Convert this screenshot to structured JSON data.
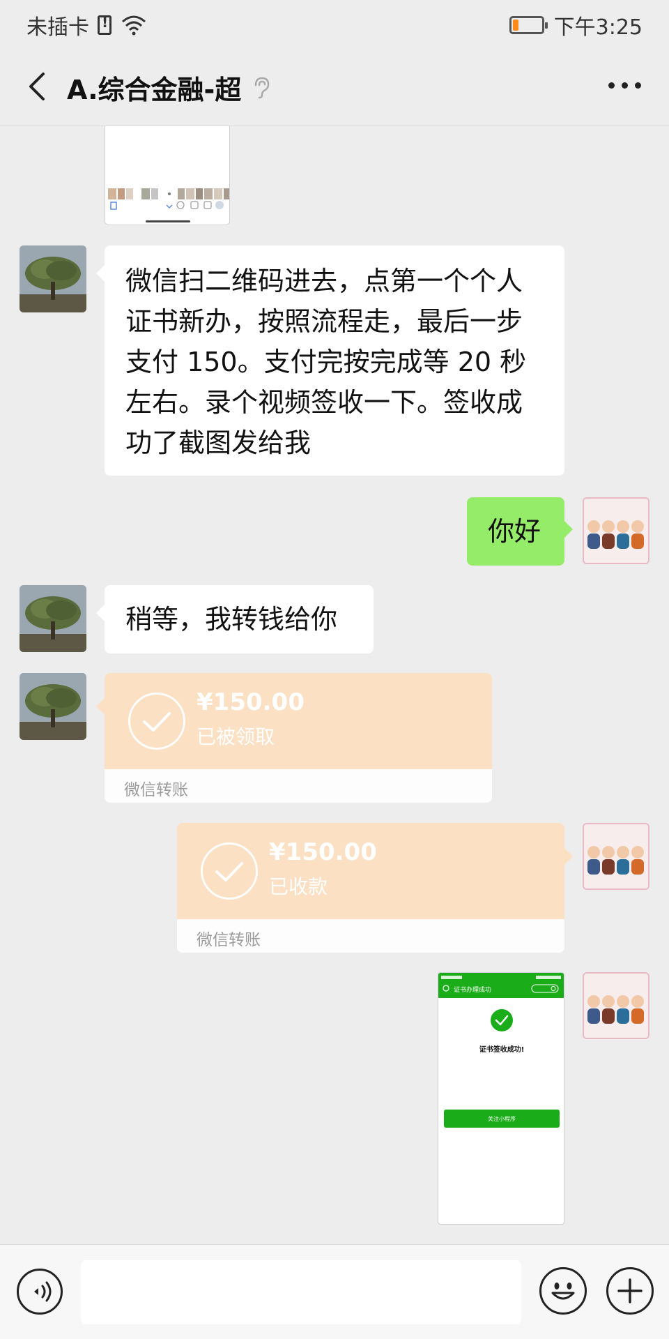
{
  "status_bar": {
    "carrier": "未插卡",
    "time": "下午3:25",
    "battery_level": 0.2,
    "battery_color": "#ff8a1a"
  },
  "header": {
    "title": "A.综合金融-超",
    "back_icon": "chevron-left-icon",
    "mute_icon": "ear-icon",
    "more_icon": "more-dots-icon"
  },
  "messages": [
    {
      "type": "image",
      "side": "in"
    },
    {
      "type": "text",
      "side": "in",
      "text": "微信扫二维码进去，点第一个个人证书新办，按照流程走，最后一步支付 150。支付完按完成等 20 秒左右。录个视频签收一下。签收成功了截图发给我"
    },
    {
      "type": "text",
      "side": "out",
      "text": "你好"
    },
    {
      "type": "text",
      "side": "in",
      "text": "稍等，我转钱给你"
    },
    {
      "type": "transfer",
      "side": "in",
      "amount": "¥150.00",
      "status": "已被领取",
      "label": "微信转账"
    },
    {
      "type": "transfer",
      "side": "out",
      "amount": "¥150.00",
      "status": "已收款",
      "label": "微信转账"
    },
    {
      "type": "image",
      "side": "out",
      "inner_title": "证书办理成功",
      "inner_text": "证书签收成功!",
      "inner_button": "关注小程序"
    }
  ],
  "colors": {
    "outgoing_bubble": "#95ec69",
    "incoming_bubble": "#ffffff",
    "transfer_bg": "#fbe0c3",
    "wechat_green": "#1aad19"
  },
  "input_bar": {
    "voice_icon": "voice-icon",
    "emoji_icon": "emoji-icon",
    "plus_icon": "plus-icon",
    "placeholder": ""
  }
}
